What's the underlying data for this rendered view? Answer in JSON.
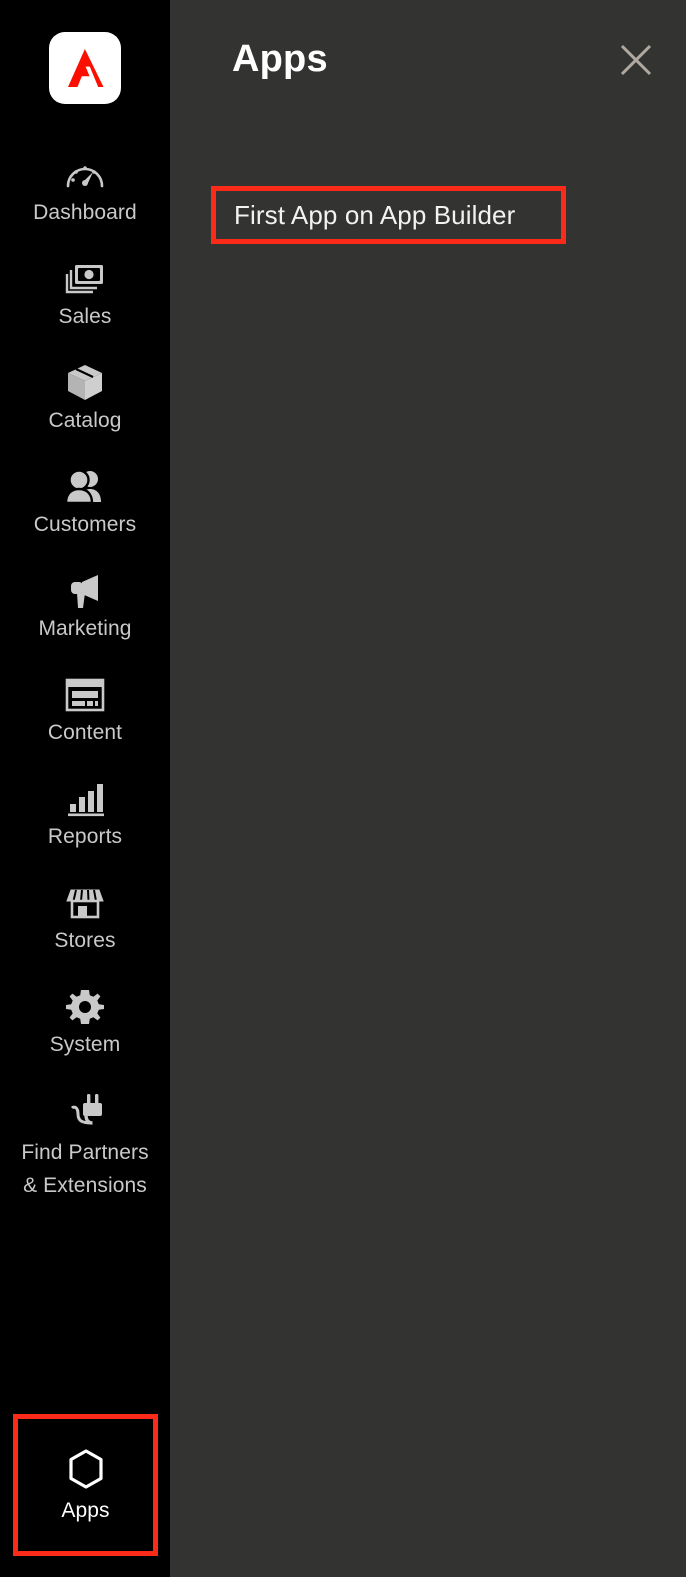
{
  "brand": {
    "logo_icon": "adobe-logo-icon",
    "logo_bg": "#ffffff",
    "logo_mark_color": "#fa0f00"
  },
  "colors": {
    "sidebar_bg": "#000000",
    "panel_bg": "#333331",
    "label": "#c9c9c9",
    "icon": "#c9c9c9",
    "highlight": "#fc2a19",
    "title": "#ffffff",
    "close_icon": "#b0a9a0"
  },
  "sidebar": {
    "items": [
      {
        "label": "Dashboard",
        "icon": "gauge-icon",
        "lines": 1
      },
      {
        "label": "Sales",
        "icon": "money-icon",
        "lines": 1
      },
      {
        "label": "Catalog",
        "icon": "box-icon",
        "lines": 1
      },
      {
        "label": "Customers",
        "icon": "users-icon",
        "lines": 1
      },
      {
        "label": "Marketing",
        "icon": "megaphone-icon",
        "lines": 1
      },
      {
        "label": "Content",
        "icon": "page-layout-icon",
        "lines": 1
      },
      {
        "label": "Reports",
        "icon": "bar-chart-icon",
        "lines": 1
      },
      {
        "label": "Stores",
        "icon": "storefront-icon",
        "lines": 1
      },
      {
        "label": "System",
        "icon": "gear-icon",
        "lines": 1
      },
      {
        "label": "Find Partners\n& Extensions",
        "icon": "plug-icon",
        "lines": 2
      }
    ],
    "partners": {
      "line1": "Find Partners",
      "line2": "& Extensions"
    },
    "apps": {
      "label": "Apps",
      "icon": "hexagon-icon",
      "highlighted": true
    }
  },
  "panel": {
    "title": "Apps",
    "close_label": "close-icon",
    "apps": [
      {
        "name": "First App on App Builder",
        "highlighted": true
      }
    ]
  }
}
